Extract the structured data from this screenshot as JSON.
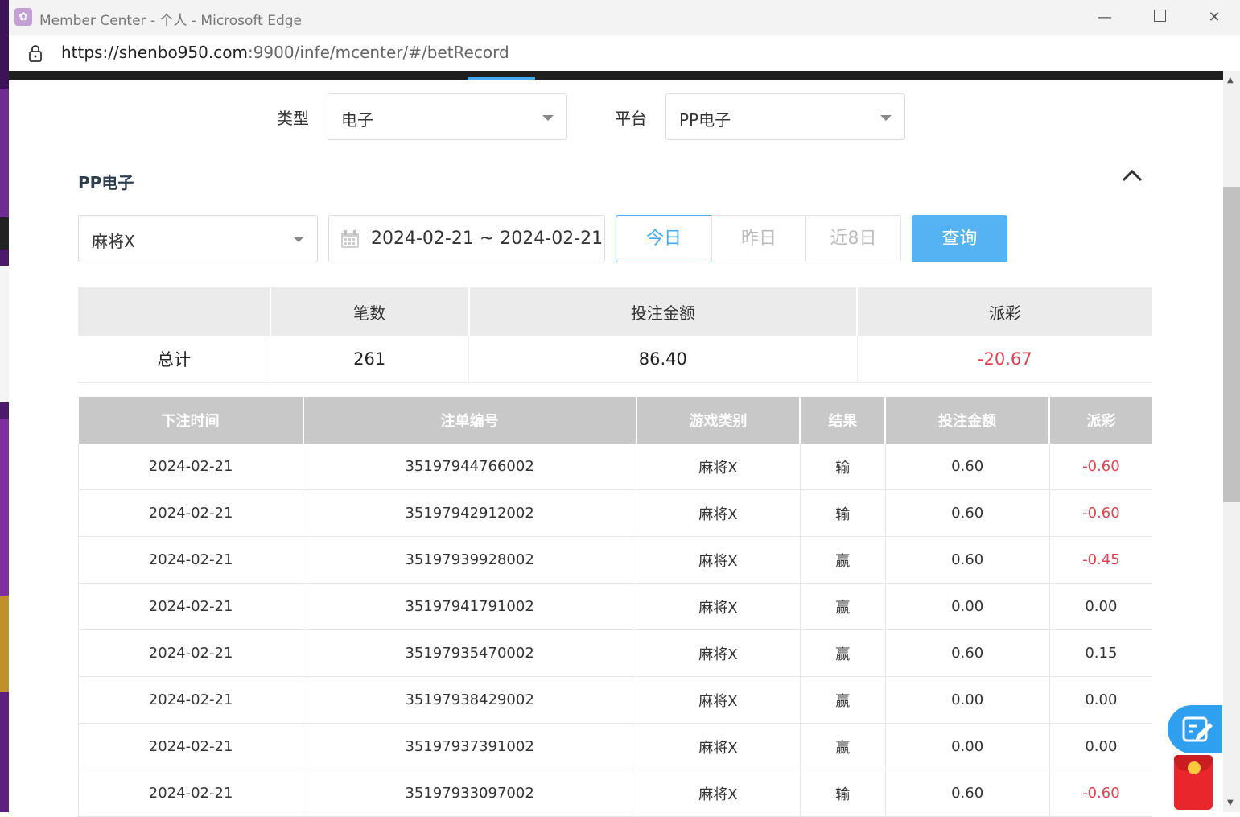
{
  "window": {
    "title": "Member Center - 个人 - Microsoft Edge",
    "url_main": "https://shenbo950.com",
    "url_rest": ":9900/infe/mcenter/#/betRecord"
  },
  "filters": {
    "type_label": "类型",
    "type_value": "电子",
    "platform_label": "平台",
    "platform_value": "PP电子"
  },
  "section": {
    "title": "PP电子"
  },
  "query": {
    "game_value": "麻将X",
    "date_range": "2024-02-21 ~ 2024-02-21",
    "today_label": "今日",
    "yesterday_label": "昨日",
    "last8_label": "近8日",
    "submit_label": "查询"
  },
  "summary": {
    "headers": [
      "",
      "笔数",
      "投注金额",
      "派彩"
    ],
    "row_label": "总计",
    "count": "261",
    "bet_amount": "86.40",
    "payout": "-20.67"
  },
  "detail": {
    "headers": [
      "下注时间",
      "注单编号",
      "游戏类别",
      "结果",
      "投注金额",
      "派彩"
    ],
    "rows": [
      {
        "time": "2024-02-21",
        "id": "35197944766002",
        "game": "麻将X",
        "result": "输",
        "bet": "0.60",
        "payout": "-0.60"
      },
      {
        "time": "2024-02-21",
        "id": "35197942912002",
        "game": "麻将X",
        "result": "输",
        "bet": "0.60",
        "payout": "-0.60"
      },
      {
        "time": "2024-02-21",
        "id": "35197939928002",
        "game": "麻将X",
        "result": "赢",
        "bet": "0.60",
        "payout": "-0.45"
      },
      {
        "time": "2024-02-21",
        "id": "35197941791002",
        "game": "麻将X",
        "result": "赢",
        "bet": "0.00",
        "payout": "0.00"
      },
      {
        "time": "2024-02-21",
        "id": "35197935470002",
        "game": "麻将X",
        "result": "赢",
        "bet": "0.60",
        "payout": "0.15"
      },
      {
        "time": "2024-02-21",
        "id": "35197938429002",
        "game": "麻将X",
        "result": "赢",
        "bet": "0.00",
        "payout": "0.00"
      },
      {
        "time": "2024-02-21",
        "id": "35197937391002",
        "game": "麻将X",
        "result": "赢",
        "bet": "0.00",
        "payout": "0.00"
      },
      {
        "time": "2024-02-21",
        "id": "35197933097002",
        "game": "麻将X",
        "result": "输",
        "bet": "0.60",
        "payout": "-0.60"
      }
    ]
  },
  "colors": {
    "accent": "#45aaf2",
    "negative": "#e83f4e"
  }
}
